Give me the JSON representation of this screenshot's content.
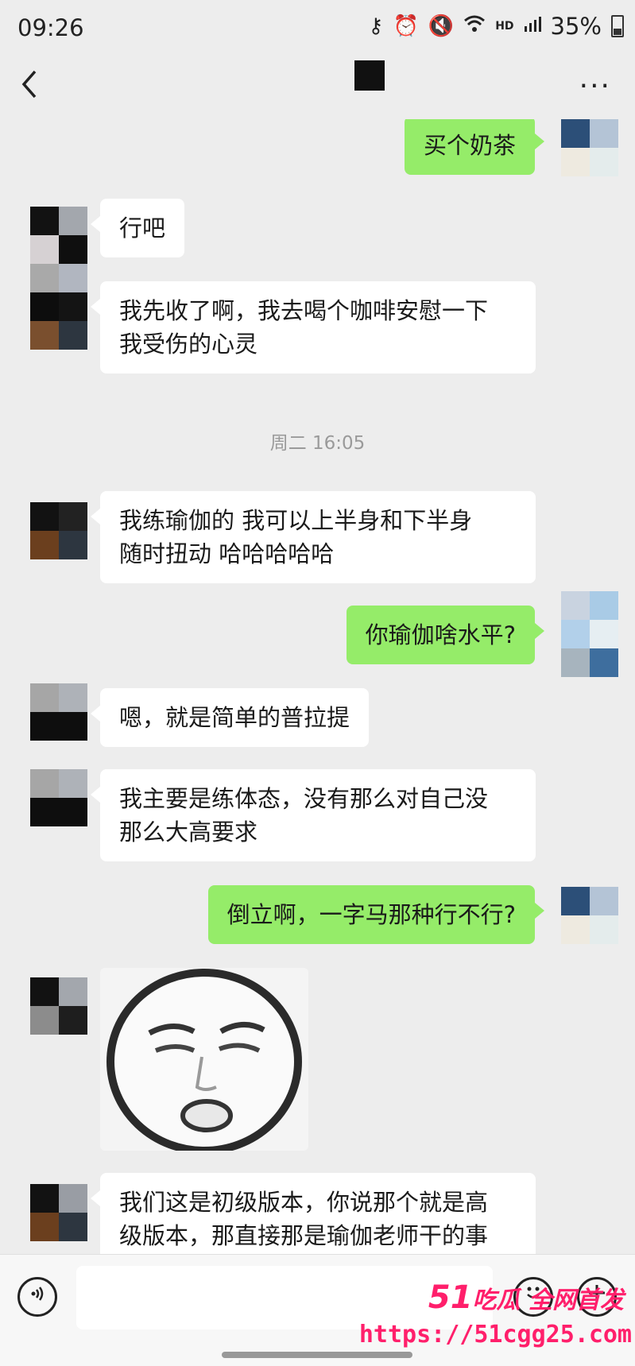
{
  "status_bar": {
    "time": "09:26",
    "hd": "HD",
    "battery": "35%"
  },
  "header": {
    "back_icon": "chevron-left-icon",
    "more": "···"
  },
  "messages": [
    {
      "side": "out",
      "text": "买个奶茶"
    },
    {
      "side": "in",
      "text": "行吧"
    },
    {
      "side": "in",
      "text": "我先收了啊，我去喝个咖啡安慰一下\n我受伤的心灵"
    },
    {
      "type": "time",
      "text": "周二 16:05"
    },
    {
      "side": "in",
      "text": "我练瑜伽的 我可以上半身和下半身\n随时扭动 哈哈哈哈哈"
    },
    {
      "side": "out",
      "text": "你瑜伽啥水平?"
    },
    {
      "side": "in",
      "text": "嗯，就是简单的普拉提"
    },
    {
      "side": "in",
      "text": "我主要是练体态，没有那么对自己没\n那么大高要求"
    },
    {
      "side": "out",
      "text": "倒立啊，一字马那种行不行?"
    },
    {
      "side": "in",
      "type": "sticker"
    },
    {
      "side": "in",
      "text": "我们这是初级版本，你说那个就是高\n级版本，那直接那是瑜伽老师干的事"
    }
  ],
  "input_bar": {
    "voice_icon": "voice-icon",
    "emoji_icon": "emoji-icon",
    "plus_icon": "plus-icon"
  },
  "watermark": {
    "num": "51",
    "tagline": "吃瓜 全网首发",
    "url": "https://51cgg25.com"
  },
  "colors": {
    "background": "#ededed",
    "bubble_in": "#ffffff",
    "bubble_out": "#95ec69",
    "watermark": "#ff1f6b"
  }
}
